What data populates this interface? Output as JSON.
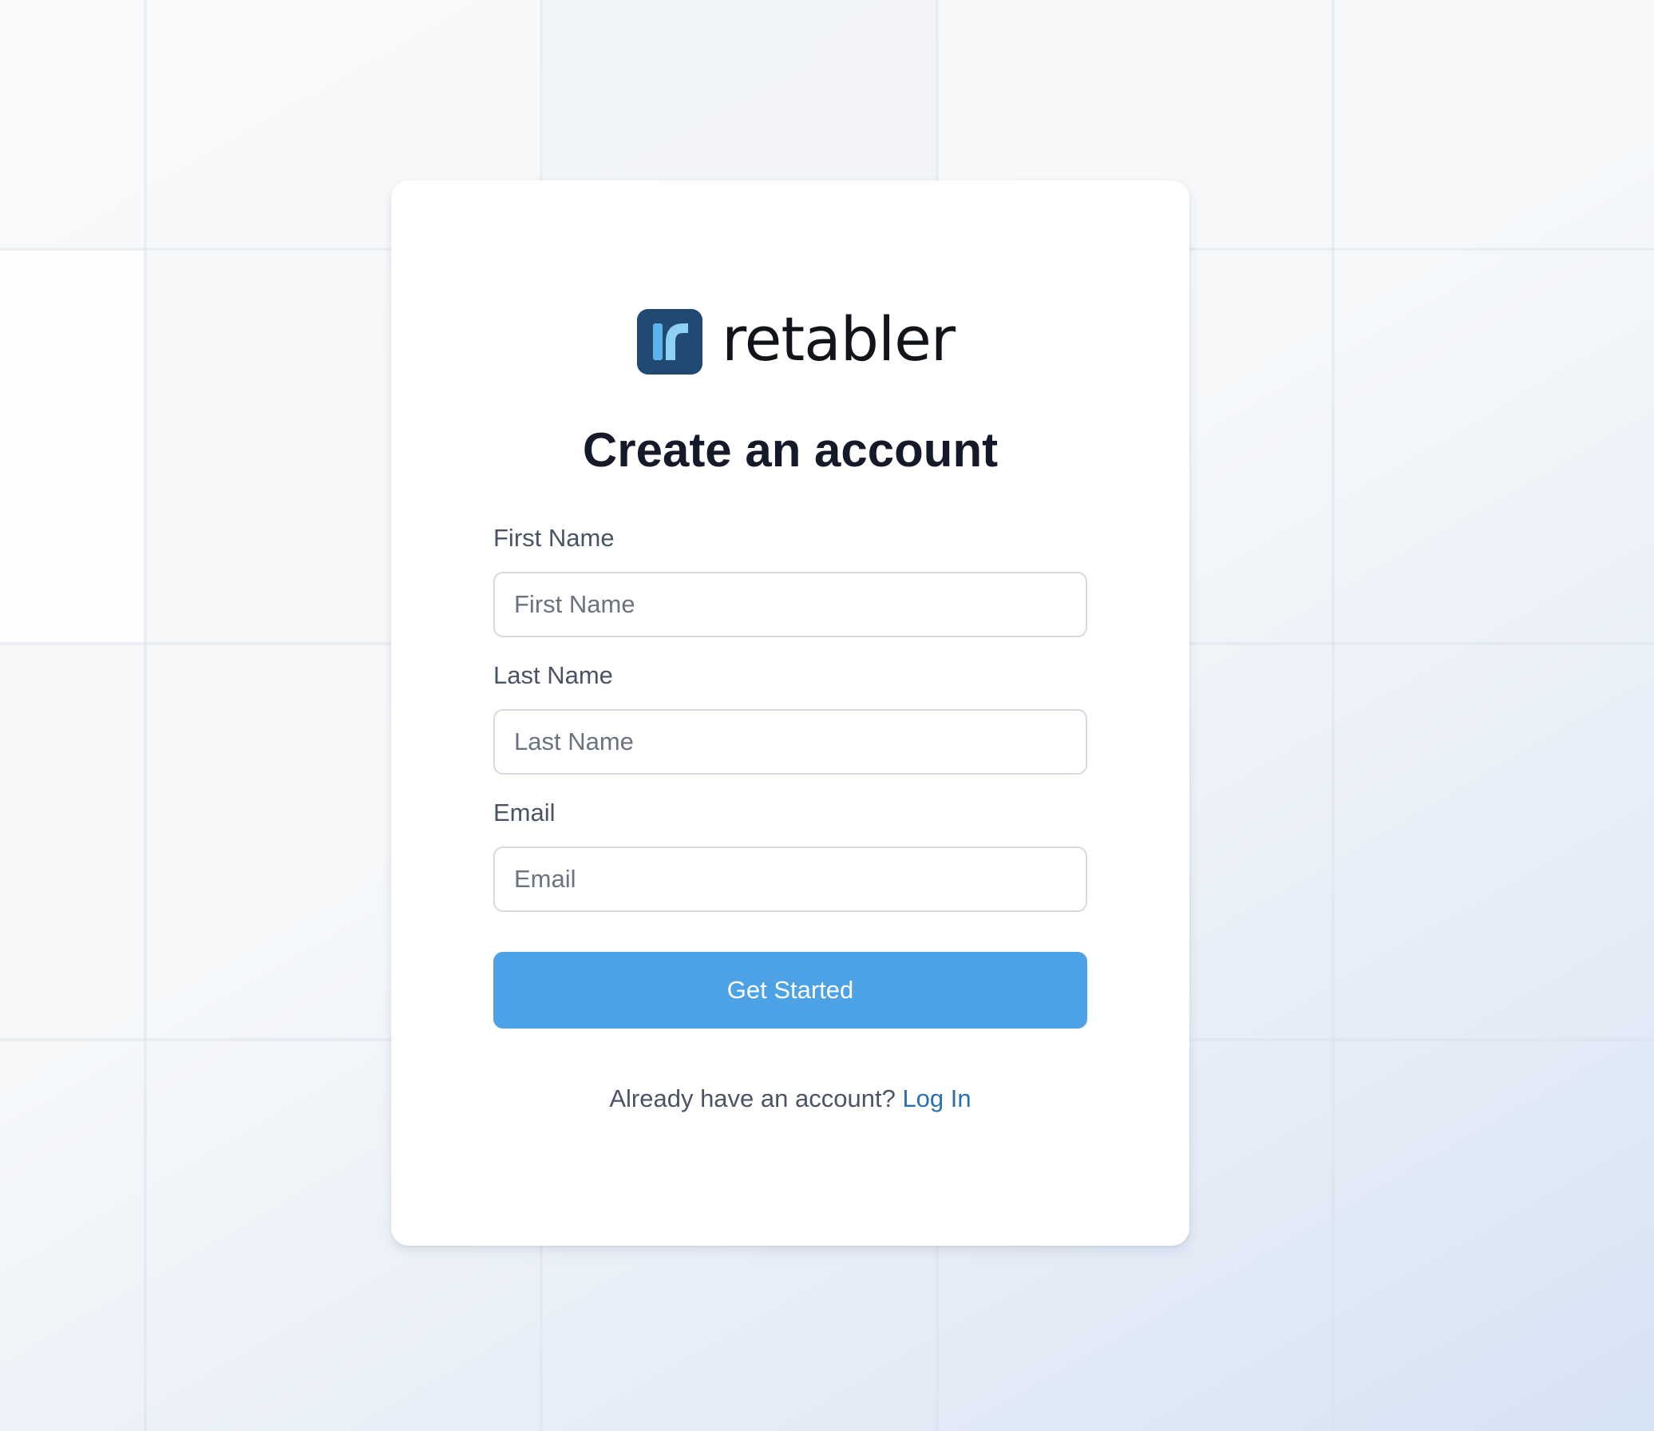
{
  "brand": {
    "name": "retabler",
    "logo_icon": "retabler-logo-icon",
    "logo_color": "#214a73",
    "logo_accent": "#5bb3ea"
  },
  "form": {
    "title": "Create an account",
    "fields": {
      "first_name": {
        "label": "First Name",
        "placeholder": "First Name",
        "value": ""
      },
      "last_name": {
        "label": "Last Name",
        "placeholder": "Last Name",
        "value": ""
      },
      "email": {
        "label": "Email",
        "placeholder": "Email",
        "value": ""
      }
    },
    "submit_label": "Get Started",
    "submit_color": "#4da2e6"
  },
  "footer": {
    "prompt": "Already have an account?",
    "link_label": "Log In",
    "link_color": "#2a6fb0"
  }
}
